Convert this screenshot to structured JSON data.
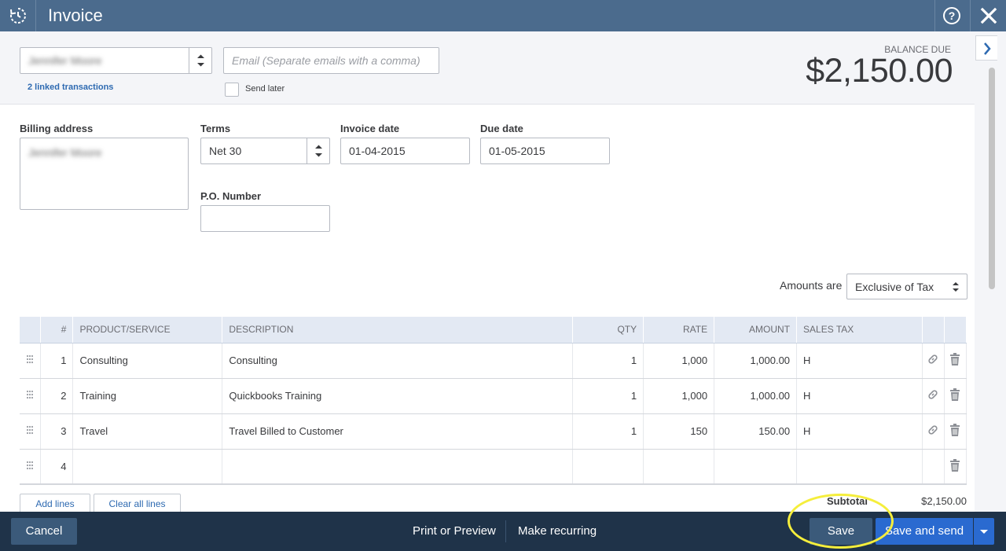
{
  "header": {
    "title": "Invoice",
    "help_glyph": "?",
    "close_glyph": "✕",
    "icons": {
      "left": "recent-transactions-icon",
      "help": "help-icon",
      "close": "close-icon"
    }
  },
  "customer": {
    "name": "Jennifer Moore",
    "email_placeholder": "Email (Separate emails with a comma)",
    "linked_transactions": "2 linked transactions",
    "send_later_label": "Send later"
  },
  "balance": {
    "label": "BALANCE DUE",
    "amount": "$2,150.00"
  },
  "fields": {
    "billing_address_label": "Billing address",
    "billing_address_value": "Jennifer Moore",
    "terms_label": "Terms",
    "terms_value": "Net 30",
    "invoice_date_label": "Invoice date",
    "invoice_date_value": "01-04-2015",
    "due_date_label": "Due date",
    "due_date_value": "01-05-2015",
    "po_label": "P.O. Number",
    "po_value": ""
  },
  "amounts_are": {
    "label": "Amounts are",
    "value": "Exclusive of Tax"
  },
  "table": {
    "columns": [
      "#",
      "PRODUCT/SERVICE",
      "DESCRIPTION",
      "QTY",
      "RATE",
      "AMOUNT",
      "SALES TAX"
    ],
    "rows": [
      {
        "num": "1",
        "product": "Consulting",
        "description": "Consulting",
        "qty": "1",
        "rate": "1,000",
        "amount": "1,000.00",
        "tax": "H"
      },
      {
        "num": "2",
        "product": "Training",
        "description": "Quickbooks Training",
        "qty": "1",
        "rate": "1,000",
        "amount": "1,000.00",
        "tax": "H"
      },
      {
        "num": "3",
        "product": "Travel",
        "description": "Travel Billed to Customer",
        "qty": "1",
        "rate": "150",
        "amount": "150.00",
        "tax": "H"
      },
      {
        "num": "4",
        "product": "",
        "description": "",
        "qty": "",
        "rate": "",
        "amount": "",
        "tax": ""
      }
    ]
  },
  "table_actions": {
    "add_lines": "Add lines",
    "clear_lines": "Clear all lines"
  },
  "subtotal": {
    "label": "Subtotal",
    "value": "$2,150.00"
  },
  "footer": {
    "cancel": "Cancel",
    "print_preview": "Print or Preview",
    "make_recurring": "Make recurring",
    "save": "Save",
    "save_and_send": "Save and send"
  },
  "colors": {
    "header": "#4b6b8d",
    "footer": "#1f3349",
    "primary_button": "#2a6ad0",
    "highlight": "#f5ee3c"
  }
}
